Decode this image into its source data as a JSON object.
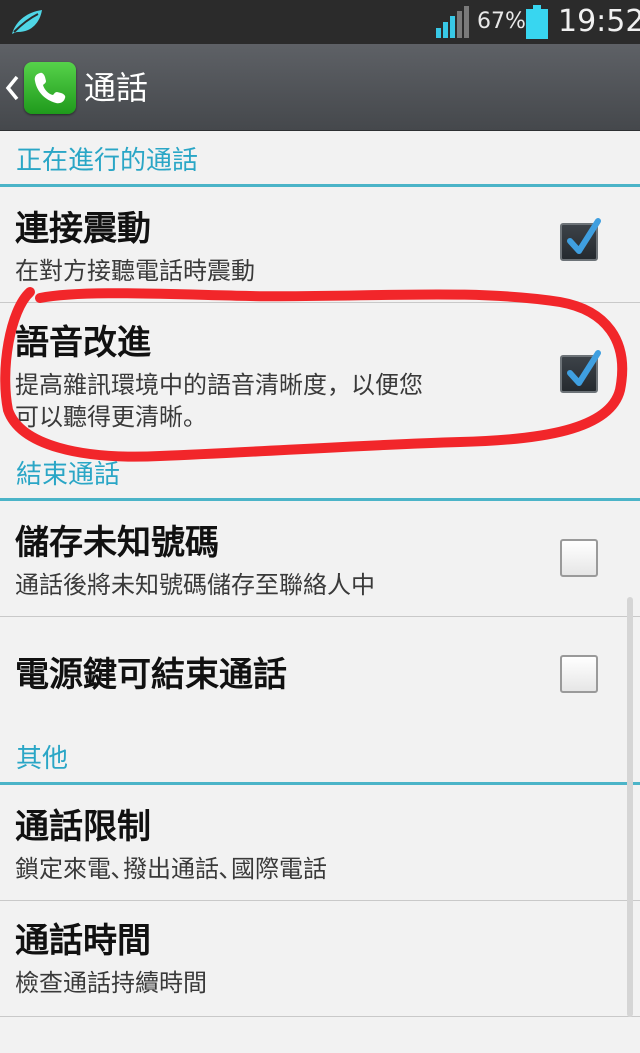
{
  "status_bar": {
    "battery_percent": "67%",
    "time": "19:52",
    "icons": [
      "leaf-icon",
      "signal-icon",
      "battery-icon"
    ]
  },
  "action_bar": {
    "title": "通話",
    "icons": [
      "back-chevron-icon",
      "phone-icon"
    ]
  },
  "sections": {
    "ongoing": {
      "header": "正在進行的通話"
    },
    "end": {
      "header": "結束通話"
    },
    "other": {
      "header": "其他"
    }
  },
  "rows": {
    "connect_vibrate": {
      "title": "連接震動",
      "summary": "在對方接聽電話時震動",
      "checked": true
    },
    "voice_enhance": {
      "title": "語音改進",
      "summary_line1": "提高雜訊環境中的語音清晰度，以便您",
      "summary_line2": "可以聽得更清晰。",
      "checked": true
    },
    "save_unknown": {
      "title": "儲存未知號碼",
      "summary": "通話後將未知號碼儲存至聯絡人中",
      "checked": false
    },
    "power_end": {
      "title": "電源鍵可結束通話",
      "checked": false
    },
    "call_barring": {
      "title": "通話限制",
      "summary": "鎖定來電､撥出通話､國際電話"
    },
    "call_duration": {
      "title": "通話時間",
      "summary": "檢查通話持續時間"
    }
  },
  "colors": {
    "accent": "#2aa6c6",
    "divider": "#4bb4c8",
    "annotation": "#f2262a",
    "check": "#3f9fe0"
  }
}
